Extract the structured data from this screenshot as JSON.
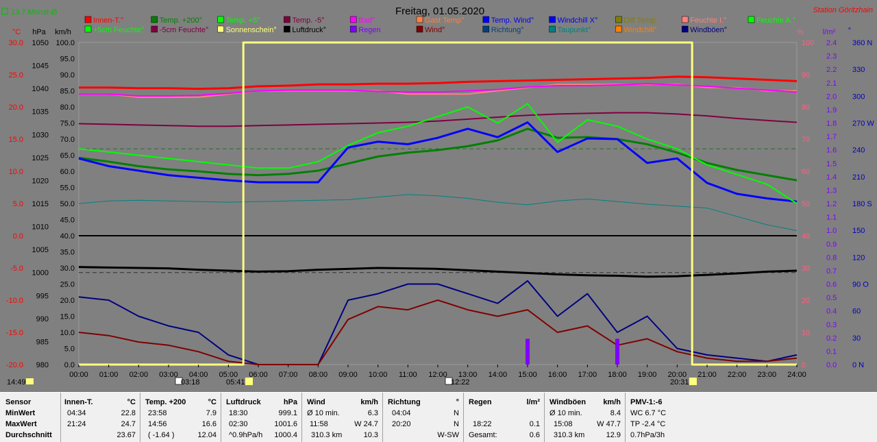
{
  "header": {
    "title": "Freitag, 01.05.2020",
    "station": "Station Göritzhain",
    "monthly_avg": "13.7 Monat-Ø"
  },
  "axes": {
    "unit_labels": {
      "c": "°C",
      "hpa": "hPa",
      "kmh": "km/h",
      "pct": "%",
      "rain": "l/m²",
      "deg": "°"
    },
    "temp_ticks": [
      "30.0",
      "25.0",
      "20.0",
      "15.0",
      "10.0",
      "5.0",
      "0.0",
      "-5.0",
      "-10.0",
      "-15.0",
      "-20.0"
    ],
    "hpa_ticks": [
      "1050",
      "1045",
      "1040",
      "1035",
      "1030",
      "1025",
      "1020",
      "1015",
      "1010",
      "1005",
      "1000",
      "995",
      "990",
      "985",
      "980"
    ],
    "kmh_ticks": [
      "100.0",
      "95.0",
      "90.0",
      "85.0",
      "80.0",
      "75.0",
      "70.0",
      "65.0",
      "60.0",
      "55.0",
      "50.0",
      "45.0",
      "40.0",
      "35.0",
      "30.0",
      "25.0",
      "20.0",
      "15.0",
      "10.0",
      "5.0",
      "0.0"
    ],
    "pct_ticks": [
      "100",
      "90",
      "80",
      "70",
      "60",
      "50",
      "40",
      "30",
      "20",
      "10",
      "0"
    ],
    "rain_ticks": [
      "2.4",
      "2.3",
      "2.2",
      "2.1",
      "2.0",
      "1.9",
      "1.8",
      "1.7",
      "1.6",
      "1.5",
      "1.4",
      "1.3",
      "1.2",
      "1.1",
      "1.0",
      "0.9",
      "0.8",
      "0.7",
      "0.6",
      "0.5",
      "0.4",
      "0.3",
      "0.2",
      "0.1",
      "0.0"
    ],
    "dir_ticks": [
      "360 N",
      "330",
      "300",
      "270 W",
      "240",
      "210",
      "180 S",
      "150",
      "120",
      "90 O",
      "60",
      "30",
      "0 N"
    ],
    "time_ticks": [
      "00:00",
      "01:00",
      "02:00",
      "03:00",
      "04:00",
      "05:00",
      "06:00",
      "07:00",
      "08:00",
      "09:00",
      "10:00",
      "11:00",
      "12:00",
      "13:00",
      "14:00",
      "15:00",
      "16:00",
      "17:00",
      "18:00",
      "19:00",
      "20:00",
      "21:00",
      "22:00",
      "23:00",
      "24:00"
    ]
  },
  "markers": {
    "clock": "14:49",
    "moon_set": "03:18",
    "sunrise": "05:41",
    "moon_rise": "12:22",
    "sunset": "20:31"
  },
  "legend": [
    {
      "label": "Innen-T.°",
      "color": "#ff0000"
    },
    {
      "label": "Temp. +200°",
      "color": "#008000"
    },
    {
      "label": "Temp. +5°",
      "color": "#00ff00"
    },
    {
      "label": "Temp. -5°",
      "color": "#800040"
    },
    {
      "label": "Bad°",
      "color": "#ff00ff"
    },
    {
      "label": "Gast Temp°",
      "color": "#ff8040"
    },
    {
      "label": "Temp. Wind°",
      "color": "#0000ff"
    },
    {
      "label": "Windchill X°",
      "color": "#0000ff"
    },
    {
      "label": "Diff Temp.",
      "color": "#808000"
    },
    {
      "label": "Feuchte I.°",
      "color": "#ff8080"
    },
    {
      "label": "Feuchte A.°",
      "color": "#00ff00"
    },
    {
      "label": "+5cm Feuchte°",
      "color": "#00ff00"
    },
    {
      "label": "-5cm Feuchte°",
      "color": "#800040"
    },
    {
      "label": "Sonnenschein°",
      "color": "#ffff80"
    },
    {
      "label": "Luftdruck°",
      "color": "#000000"
    },
    {
      "label": "Regen",
      "color": "#8000ff"
    },
    {
      "label": "Wind°",
      "color": "#800000"
    },
    {
      "label": "Richtung°",
      "color": "#004080"
    },
    {
      "label": "Taupunkt°",
      "color": "#008080"
    },
    {
      "label": "Windchill°",
      "color": "#ff8000"
    },
    {
      "label": "Windböen°",
      "color": "#000080"
    }
  ],
  "chart_data": {
    "type": "line",
    "title": "Freitag, 01.05.2020",
    "x_range": [
      "00:00",
      "24:00"
    ],
    "left_axis": {
      "unit": "°C",
      "range": [
        -20,
        30
      ]
    },
    "pressure_axis": {
      "unit": "hPa",
      "range": [
        980,
        1050
      ]
    },
    "speed_axis": {
      "unit": "km/h",
      "range": [
        0,
        100
      ]
    },
    "humidity_axis": {
      "unit": "%",
      "range": [
        0,
        100
      ]
    },
    "rain_axis": {
      "unit": "l/m²",
      "range": [
        0,
        2.5
      ]
    },
    "direction_axis": {
      "unit": "°",
      "range": [
        0,
        360
      ]
    },
    "x_hours": [
      0,
      1,
      2,
      3,
      4,
      5,
      6,
      7,
      8,
      9,
      10,
      11,
      12,
      13,
      14,
      15,
      16,
      17,
      18,
      19,
      20,
      21,
      22,
      23,
      24
    ],
    "series": [
      {
        "name": "Innen-T.°",
        "unit": "°C",
        "color": "#ff0000",
        "width": 3,
        "y": [
          23.0,
          23.0,
          22.9,
          22.9,
          22.8,
          22.9,
          23.2,
          23.3,
          23.5,
          23.5,
          23.6,
          23.6,
          23.7,
          23.9,
          24.0,
          24.1,
          24.2,
          24.3,
          24.4,
          24.5,
          24.7,
          24.6,
          24.4,
          24.2,
          24.0
        ]
      },
      {
        "name": "Feuchte I.°",
        "unit": "%",
        "color": "#ff8080",
        "width": 2,
        "y": [
          84,
          84,
          83,
          83,
          83,
          84,
          85,
          85,
          85,
          85,
          85,
          84,
          84,
          84,
          85,
          86,
          87,
          87,
          87,
          87,
          87,
          86,
          86,
          85,
          85
        ]
      },
      {
        "name": "Bad°",
        "unit": "°C",
        "color": "#ff00ff",
        "width": 2,
        "y": [
          22.0,
          22.0,
          21.7,
          21.7,
          21.8,
          22.1,
          22.5,
          22.6,
          22.6,
          22.6,
          22.4,
          22.3,
          22.3,
          22.5,
          22.7,
          23.1,
          23.3,
          23.3,
          23.4,
          23.6,
          23.4,
          23.2,
          22.9,
          22.6,
          22.3
        ]
      },
      {
        "name": "Temp. -5°",
        "unit": "°C",
        "color": "#800040",
        "width": 2,
        "y": [
          17.4,
          17.3,
          17.2,
          17.1,
          17.0,
          17.0,
          17.1,
          17.2,
          17.3,
          17.4,
          17.5,
          17.6,
          17.8,
          18.1,
          18.4,
          18.7,
          18.9,
          19.0,
          19.1,
          19.1,
          18.9,
          18.6,
          18.2,
          17.9,
          17.6
        ]
      },
      {
        "name": "Temp. +200°",
        "unit": "°C",
        "color": "#008000",
        "width": 3,
        "y": [
          12.1,
          11.5,
          10.8,
          10.3,
          10.0,
          9.6,
          9.4,
          9.6,
          10.1,
          11.2,
          12.3,
          12.9,
          13.3,
          13.9,
          14.8,
          16.6,
          15.2,
          15.3,
          15.0,
          14.2,
          12.9,
          11.3,
          10.2,
          9.4,
          8.6
        ]
      },
      {
        "name": "Temp. Wind°",
        "unit": "°C",
        "color": "#0000ff",
        "width": 3,
        "y": [
          12.0,
          10.8,
          10.1,
          9.4,
          9.0,
          8.6,
          8.3,
          8.3,
          8.3,
          13.7,
          14.6,
          14.2,
          15.2,
          16.6,
          15.3,
          17.6,
          13.0,
          15.1,
          15.0,
          11.3,
          12.0,
          8.2,
          6.5,
          5.8,
          5.3
        ]
      },
      {
        "name": "Feuchte A.°",
        "unit": "%",
        "color": "#00ff00",
        "width": 2,
        "y": [
          67,
          66,
          65,
          64,
          63,
          62,
          61,
          61,
          63,
          68,
          72,
          74,
          77,
          80,
          75,
          81,
          69,
          76,
          74,
          70,
          67,
          62,
          59,
          56,
          50
        ]
      },
      {
        "name": "Taupunkt°",
        "unit": "°C",
        "color": "#008080",
        "width": 1,
        "y": [
          5.0,
          5.4,
          5.5,
          5.4,
          5.3,
          5.2,
          5.3,
          5.4,
          5.5,
          5.6,
          6.0,
          6.4,
          6.2,
          5.8,
          5.2,
          4.8,
          5.4,
          5.7,
          5.3,
          4.9,
          4.6,
          4.3,
          3.0,
          1.7,
          0.8
        ]
      },
      {
        "name": "Luftdruck°",
        "unit": "hPa",
        "color": "#000000",
        "width": 3,
        "y": [
          1001.2,
          1001.1,
          1001.0,
          1000.9,
          1000.6,
          1000.4,
          1000.2,
          1000.3,
          1000.6,
          1000.8,
          1001.0,
          1000.9,
          1000.8,
          1000.5,
          1000.2,
          999.9,
          999.6,
          999.4,
          999.3,
          999.1,
          999.2,
          999.5,
          999.8,
          1000.2,
          1000.4
        ]
      },
      {
        "name": "Windböen°",
        "unit": "km/h",
        "color": "#000080",
        "width": 2,
        "y": [
          21,
          20,
          15,
          12,
          10,
          3,
          0,
          0,
          0,
          20,
          22,
          25,
          25,
          22,
          19,
          26,
          15,
          22,
          10,
          15,
          5,
          3,
          2,
          1,
          3
        ]
      },
      {
        "name": "Wind°",
        "unit": "km/h",
        "color": "#800000",
        "width": 2,
        "y": [
          10,
          9,
          7,
          6,
          4,
          1,
          0,
          0,
          0,
          14,
          18,
          17,
          20,
          17,
          15,
          17,
          10,
          12,
          6,
          8,
          4,
          2,
          1,
          1,
          2
        ]
      },
      {
        "name": "Sonnenschein°",
        "unit": "%",
        "color": "#ffff80",
        "width": 3,
        "y": [
          0,
          0,
          0,
          0,
          0,
          0,
          100,
          100,
          100,
          100,
          100,
          100,
          100,
          100,
          100,
          100,
          100,
          100,
          100,
          100,
          100,
          0,
          0,
          0,
          0
        ]
      },
      {
        "name": "Regen",
        "unit": "l/m²",
        "color": "#8000ff",
        "width": 2,
        "y": [
          0,
          0,
          0,
          0,
          0,
          0,
          0,
          0,
          0,
          0,
          0,
          0,
          0,
          0,
          0,
          0.2,
          0,
          0,
          0.2,
          0,
          0,
          0,
          0,
          0,
          0
        ]
      }
    ]
  },
  "stats": {
    "sensor": {
      "header": "Sensor",
      "rows": [
        "MinWert",
        "MaxWert",
        "Durchschnitt"
      ]
    },
    "innen": {
      "header": "Innen-T.",
      "unit": "°C",
      "rows": [
        [
          "04:34",
          "22.8"
        ],
        [
          "21:24",
          "24.7"
        ],
        [
          "",
          "23.67"
        ]
      ]
    },
    "temp200": {
      "header": "Temp. +200",
      "unit": "°C",
      "rows": [
        [
          "23:58",
          "7.9"
        ],
        [
          "14:56",
          "16.6"
        ],
        [
          "( -1.64 )",
          "12.04"
        ]
      ]
    },
    "luftdruck": {
      "header": "Luftdruck",
      "unit": "hPa",
      "rows": [
        [
          "18:30",
          "999.1"
        ],
        [
          "02:30",
          "1001.6"
        ],
        [
          "^0.9hPa/h",
          "1000.4"
        ]
      ]
    },
    "wind": {
      "header": "Wind",
      "unit": "km/h",
      "rows": [
        [
          "Ø 10 min.",
          "6.3"
        ],
        [
          "11:58",
          "W 24.7"
        ],
        [
          "310.3 km",
          "10.3"
        ]
      ]
    },
    "richtung": {
      "header": "Richtung",
      "unit": "°",
      "rows": [
        [
          "04:04",
          "N"
        ],
        [
          "20:20",
          "N"
        ],
        [
          "",
          "W-SW"
        ]
      ]
    },
    "regen": {
      "header": "Regen",
      "unit": "l/m²",
      "rows": [
        [
          "",
          ""
        ],
        [
          "18:22",
          "0.1"
        ],
        [
          "Gesamt:",
          "0.6"
        ]
      ]
    },
    "windboeen": {
      "header": "Windböen",
      "unit": "km/h",
      "rows": [
        [
          "Ø 10 min.",
          "8.4"
        ],
        [
          "15:08",
          "W 47.7"
        ],
        [
          "310.3 km",
          "12.9"
        ]
      ]
    },
    "pmv": {
      "header": "PMV-1:-6",
      "rows": [
        "WC 6.7 °C",
        "TP -2.4 °C",
        "0.7hPa/3h"
      ]
    }
  }
}
